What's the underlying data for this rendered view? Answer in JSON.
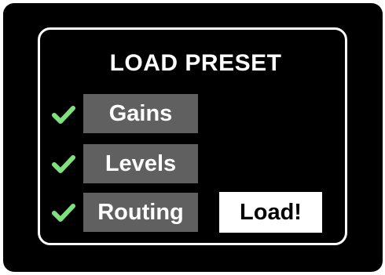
{
  "dialog": {
    "title": "LOAD PRESET"
  },
  "options": [
    {
      "label": "Gains",
      "checked": true,
      "icon": "checkmark-icon"
    },
    {
      "label": "Levels",
      "checked": true,
      "icon": "checkmark-icon"
    },
    {
      "label": "Routing",
      "checked": true,
      "icon": "checkmark-icon"
    }
  ],
  "load_button": {
    "label": "Load!"
  },
  "colors": {
    "background": "#000000",
    "check": "#7ee07e",
    "option_bg": "#606060",
    "button_bg": "#ffffff"
  }
}
